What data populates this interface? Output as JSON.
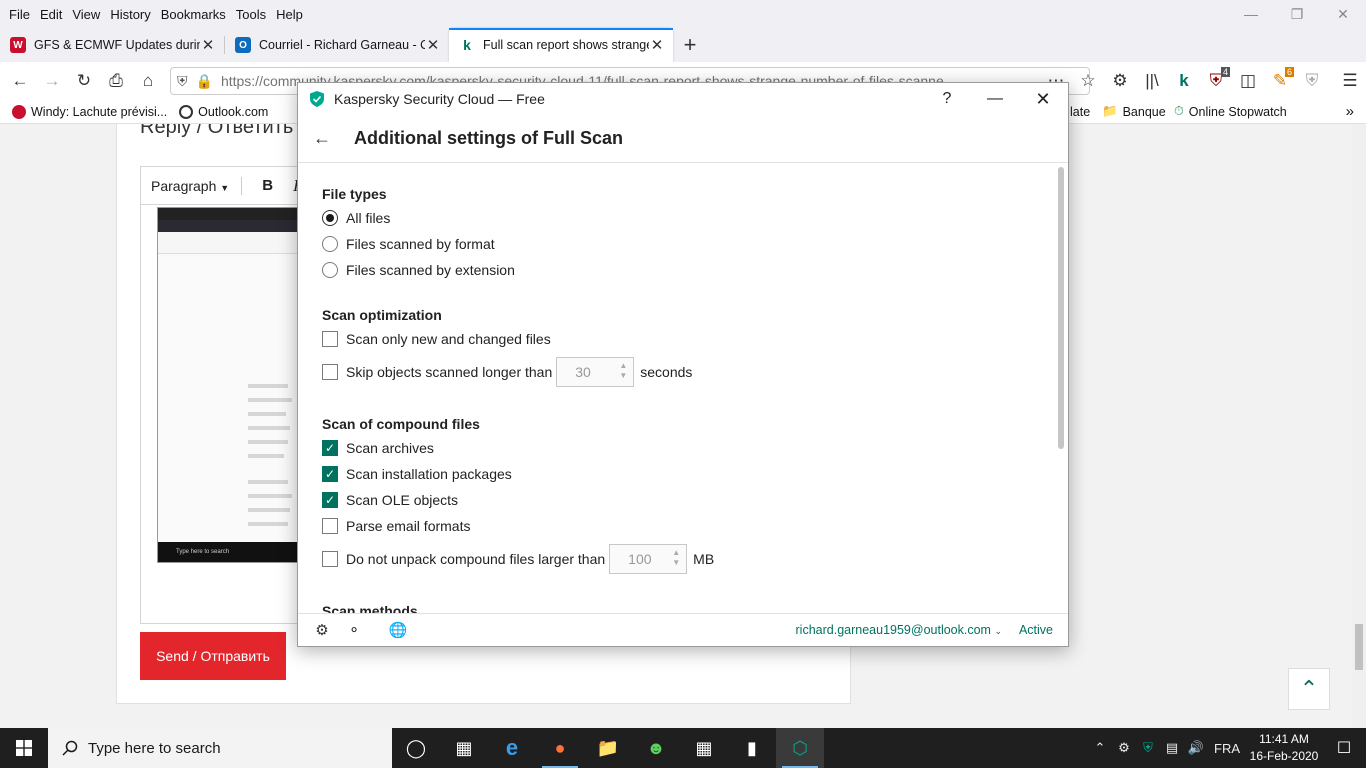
{
  "menubar": {
    "items": [
      "File",
      "Edit",
      "View",
      "History",
      "Bookmarks",
      "Tools",
      "Help"
    ]
  },
  "tabs": [
    {
      "title": "GFS & ECMWF Updates during",
      "color": "#c8102e"
    },
    {
      "title": "Courriel - Richard Garneau - O",
      "color": "#0f6cbd"
    },
    {
      "title": "Full scan report shows strange",
      "color": "#00725f"
    }
  ],
  "navbar": {
    "url": "https://community.kaspersky.com/kaspersky-security-cloud-11/full-scan-report-shows-strange-number-of-files-scanne",
    "badge_ublock": "4",
    "badge_ext": "6"
  },
  "bookmarks": [
    {
      "label": "Windy: Lachute prévisi...",
      "color": "#c8102e"
    },
    {
      "label": "Outlook.com",
      "color": "#333333"
    },
    {
      "label": "late",
      "color": ""
    },
    {
      "label": "Banque",
      "color": ""
    },
    {
      "label": "Online Stopwatch",
      "color": "#2e8b57"
    }
  ],
  "page": {
    "reply_title": "Reply / Ответить",
    "editor_style": "Paragraph",
    "bold": "B",
    "italic": "I",
    "search_placeholder": "Type here to search",
    "send_label": "Send / Отправить"
  },
  "dialog": {
    "app_title": "Kaspersky Security Cloud — Free",
    "help": "?",
    "heading": "Additional settings of Full Scan",
    "sections": {
      "file_types": {
        "title": "File types",
        "options": [
          {
            "label": "All files",
            "selected": true
          },
          {
            "label": "Files scanned by format",
            "selected": false
          },
          {
            "label": "Files scanned by extension",
            "selected": false
          }
        ]
      },
      "optimization": {
        "title": "Scan optimization",
        "new_changed": {
          "label": "Scan only new and changed files",
          "checked": false
        },
        "skip": {
          "label": "Skip objects scanned longer than",
          "value": "30",
          "unit": "seconds",
          "checked": false
        }
      },
      "compound": {
        "title": "Scan of compound files",
        "options": [
          {
            "label": "Scan archives",
            "checked": true
          },
          {
            "label": "Scan installation packages",
            "checked": true
          },
          {
            "label": "Scan OLE objects",
            "checked": true
          },
          {
            "label": "Parse email formats",
            "checked": false
          }
        ],
        "unpack": {
          "label": "Do not unpack compound files larger than",
          "value": "100",
          "unit": "MB",
          "checked": false
        }
      },
      "methods": {
        "title": "Scan methods"
      }
    },
    "footer": {
      "account": "richard.garneau1959@outlook.com",
      "status": "Active"
    }
  },
  "taskbar": {
    "search_placeholder": "Type here to search",
    "lang": "FRA",
    "time": "11:41 AM",
    "date": "16-Feb-2020"
  },
  "colors": {
    "kaspersky_green": "#00725f",
    "send_red": "#e3262b",
    "firefox_accent": "#0a84ff"
  }
}
